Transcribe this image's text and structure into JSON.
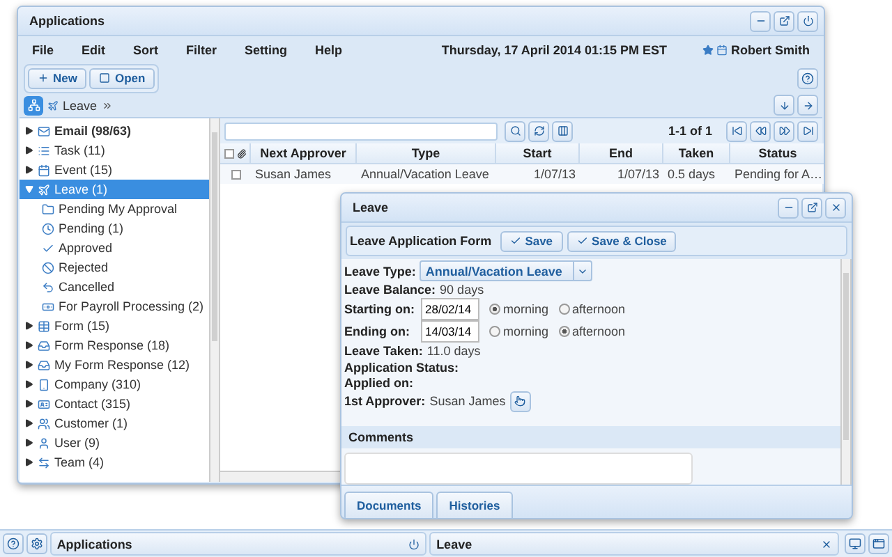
{
  "app_window": {
    "title": "Applications",
    "menu": [
      "File",
      "Edit",
      "Sort",
      "Filter",
      "Setting",
      "Help"
    ],
    "datetime": "Thursday, 17 April 2014 01:15 PM EST",
    "user": "Robert Smith",
    "toolbar": [
      {
        "label": "New",
        "kind": "new"
      },
      {
        "label": "Open",
        "kind": "open"
      }
    ],
    "breadcrumb": "Leave",
    "tree": [
      {
        "label": "Email (98/63)",
        "unread": true,
        "selected": false,
        "expanded": false
      },
      {
        "label": "Task (11)",
        "unread": false,
        "selected": false,
        "expanded": false
      },
      {
        "label": "Event (15)",
        "unread": false,
        "selected": false,
        "expanded": false
      },
      {
        "label": "Leave (1)",
        "unread": false,
        "selected": true,
        "expanded": true,
        "children": [
          {
            "label": "Pending My Approval",
            "selected": false
          },
          {
            "label": "Pending (1)",
            "selected": false
          },
          {
            "label": "Approved",
            "selected": false
          },
          {
            "label": "Rejected",
            "selected": false
          },
          {
            "label": "Cancelled",
            "selected": false
          },
          {
            "label": "For Payroll Processing (2)",
            "selected": false
          }
        ]
      },
      {
        "label": "Form (15)",
        "unread": false,
        "selected": false,
        "expanded": false
      },
      {
        "label": "Form Response (18)",
        "unread": false,
        "selected": false,
        "expanded": false
      },
      {
        "label": "My Form Response (12)",
        "unread": false,
        "selected": false,
        "expanded": false
      },
      {
        "label": "Company (310)",
        "unread": false,
        "selected": false,
        "expanded": false
      },
      {
        "label": "Contact (315)",
        "unread": false,
        "selected": false,
        "expanded": false
      },
      {
        "label": "Customer (1)",
        "unread": false,
        "selected": false,
        "expanded": false
      },
      {
        "label": "User (9)",
        "unread": false,
        "selected": false,
        "expanded": false
      },
      {
        "label": "Team (4)",
        "unread": false,
        "selected": false,
        "expanded": false
      }
    ],
    "grid": {
      "pager": "1-1 of 1",
      "all_checked": false,
      "columns": [
        "Next Approver",
        "Type",
        "Start",
        "End",
        "Taken",
        "Status"
      ],
      "rows": [
        {
          "checked": false,
          "cells": [
            "Susan James",
            "Annual/Vacation Leave",
            "1/07/13",
            "1/07/13",
            "0.5 days",
            "Pending for A…"
          ]
        }
      ]
    }
  },
  "leave_window": {
    "title": "Leave",
    "form_title": "Leave Application Form",
    "buttons": [
      "Save",
      "Save & Close"
    ],
    "leave_type": {
      "label": "Leave Type:",
      "value": "Annual/Vacation Leave"
    },
    "balance": {
      "label": "Leave Balance:",
      "value": "90 days"
    },
    "dates": [
      {
        "label": "Starting on:",
        "value": "28/02/14",
        "options": [
          {
            "label": "morning",
            "selected": true
          },
          {
            "label": "afternoon",
            "selected": false
          }
        ]
      },
      {
        "label": "Ending on:",
        "value": "14/03/14",
        "options": [
          {
            "label": "morning",
            "selected": false
          },
          {
            "label": "afternoon",
            "selected": true
          }
        ]
      }
    ],
    "taken": {
      "label": "Leave Taken:",
      "value": "11.0 days"
    },
    "status": {
      "label": "Application Status:"
    },
    "applied": {
      "label": "Applied on:"
    },
    "approver": {
      "label": "1st Approver:",
      "value": "Susan James"
    },
    "comments": "Comments",
    "tabs": [
      "Documents",
      "Histories"
    ]
  },
  "taskbar": {
    "tasks": [
      {
        "label": "Applications",
        "kind": "power"
      },
      {
        "label": "Leave",
        "kind": "close"
      }
    ]
  }
}
